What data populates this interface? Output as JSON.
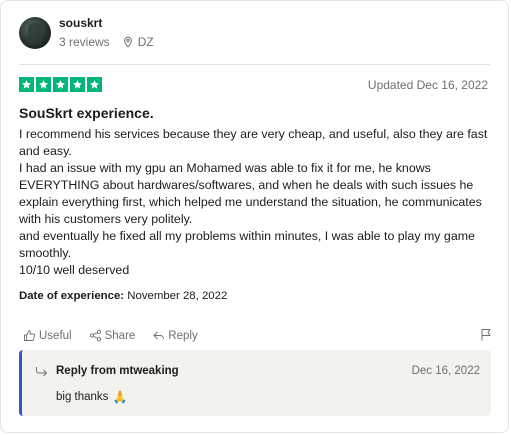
{
  "reviewer": {
    "name": "souskrt",
    "reviews": "3 reviews",
    "country": "DZ"
  },
  "review": {
    "rating": 5,
    "updated": "Updated Dec 16, 2022",
    "title": "SouSkrt experience.",
    "paragraphs": [
      "I recommend his services because they are very cheap, and useful, also they are fast and easy.",
      "I had an issue with my gpu an Mohamed was able to fix it for me, he knows EVERYTHING about hardwares/softwares, and when he deals with such issues he explain everything first, which helped me understand the situation, he communicates with his customers very politely.",
      "and eventually he fixed all my problems within minutes, I was able to play my game smoothly.",
      "10/10 well deserved"
    ],
    "date_of_experience_label": "Date of experience:",
    "date_of_experience": "November 28, 2022"
  },
  "actions": {
    "useful": "Useful",
    "share": "Share",
    "reply": "Reply"
  },
  "reply": {
    "from": "Reply from mtweaking",
    "date": "Dec 16, 2022",
    "text": "big thanks",
    "emoji": "🙏"
  },
  "colors": {
    "star_green": "#00b67a",
    "reply_accent": "#3c57bc",
    "reply_bg": "#f2f2ee",
    "muted": "#6f6f6f"
  }
}
